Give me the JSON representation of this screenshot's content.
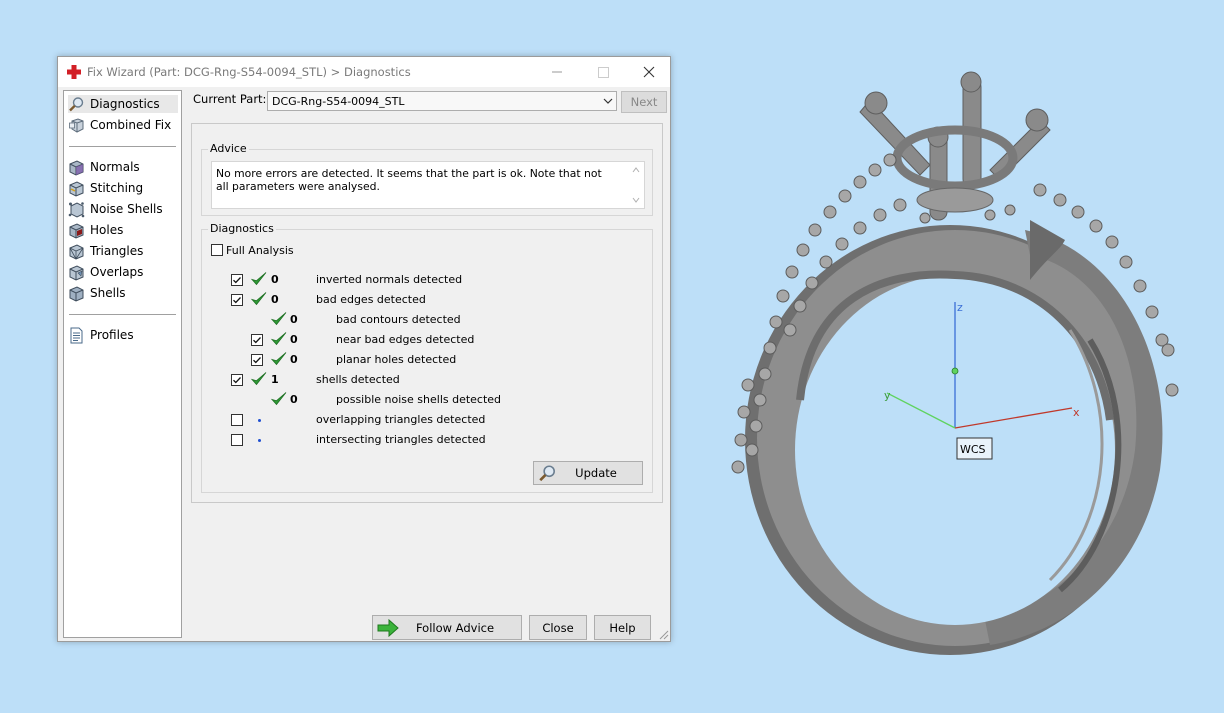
{
  "window": {
    "title": "Fix Wizard (Part: DCG-Rng-S54-0094_STL) > Diagnostics",
    "icon": "red-cross-icon"
  },
  "sidebar": {
    "items": [
      {
        "label": "Diagnostics",
        "icon": "magnifier-icon",
        "selected": true
      },
      {
        "label": "Combined Fix",
        "icon": "combined-fix-icon"
      },
      {
        "label": "Normals",
        "icon": "normals-cube-icon"
      },
      {
        "label": "Stitching",
        "icon": "stitching-cube-icon"
      },
      {
        "label": "Noise Shells",
        "icon": "noise-shells-icon"
      },
      {
        "label": "Holes",
        "icon": "holes-cube-icon"
      },
      {
        "label": "Triangles",
        "icon": "triangles-cube-icon"
      },
      {
        "label": "Overlaps",
        "icon": "overlaps-cube-icon"
      },
      {
        "label": "Shells",
        "icon": "shells-cube-icon"
      },
      {
        "label": "Profiles",
        "icon": "profiles-document-icon"
      }
    ]
  },
  "header": {
    "current_part_label": "Current Part:",
    "current_part_value": "DCG-Rng-S54-0094_STL",
    "next_label": "Next"
  },
  "advice": {
    "title": "Advice",
    "text": "No more errors are detected. It seems that the part is ok. Note that not all parameters were analysed."
  },
  "diagnostics": {
    "title": "Diagnostics",
    "full_analysis_label": "Full Analysis",
    "full_analysis_checked": false,
    "rows": [
      {
        "checked": true,
        "status": "ok",
        "count": "0",
        "label": "inverted normals detected"
      },
      {
        "checked": true,
        "status": "ok",
        "count": "0",
        "label": "bad edges detected"
      },
      {
        "checked": null,
        "status": "ok",
        "count": "0",
        "label": "bad contours detected"
      },
      {
        "checked": true,
        "status": "ok",
        "count": "0",
        "label": "near bad edges detected"
      },
      {
        "checked": true,
        "status": "ok",
        "count": "0",
        "label": "planar holes detected"
      },
      {
        "checked": true,
        "status": "ok",
        "count": "1",
        "label": "shells detected"
      },
      {
        "checked": null,
        "status": "ok",
        "count": "0",
        "label": "possible noise shells detected"
      },
      {
        "checked": false,
        "status": "pending",
        "count": "",
        "label": "overlapping triangles detected"
      },
      {
        "checked": false,
        "status": "pending",
        "count": "",
        "label": "intersecting triangles detected"
      }
    ],
    "update_label": "Update"
  },
  "footer": {
    "follow_advice_label": "Follow Advice",
    "close_label": "Close",
    "help_label": "Help"
  },
  "viewport": {
    "wcs_label": "WCS",
    "axis_x": "x",
    "axis_y": "y",
    "axis_z": "z",
    "colors": {
      "x": "#c0392b",
      "y": "#5fd35f",
      "z": "#3b6fd6",
      "background": "#bddff8",
      "model": "#8c8c8c"
    }
  }
}
